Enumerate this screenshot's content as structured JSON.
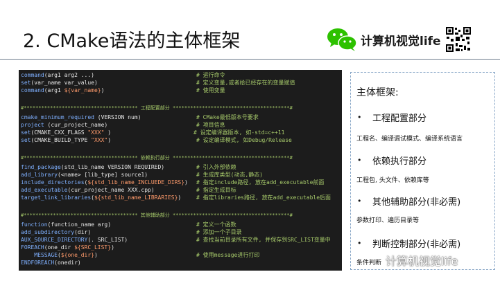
{
  "slide": {
    "title": "2. CMake语法的主体框架",
    "brand": "计算机视觉life"
  },
  "code": {
    "block1": [
      {
        "cmd": "command",
        "args": "(arg1 arg2 ...)",
        "comment": "# 运行命令"
      },
      {
        "cmd": "set",
        "args": "(var_name var_value)",
        "comment": "# 定义变量,或者给已经存在的变量赋值"
      },
      {
        "cmd": "command",
        "args": "(arg1 ${var_name})",
        "comment": "# 使用变量"
      }
    ],
    "header1": "#*************************************** 工程配置部分 ****************************************#",
    "block2": [
      {
        "cmd": "cmake_minimum_required",
        "args": " (VERSION num)",
        "comment": "# CMake最低版本号要求"
      },
      {
        "cmd": "project",
        "args": " (cur_project_name)",
        "comment": "# 项目信息"
      },
      {
        "cmd": "set",
        "args": "(CMAKE_CXX_FLAGS \"XXX\" )",
        "comment": "# 设定编译器版本, 如-std=c++11"
      },
      {
        "cmd": "set",
        "args": "(CMAKE_BUILD_TYPE \"XXX\")",
        "comment": "# 设定编译模式, 如Debug/Release"
      }
    ],
    "header2": "#*************************************** 依赖执行部分 ****************************************#",
    "block3": [
      {
        "cmd": "find_package",
        "args": "(std_lib_name VERSION REQUIRED)",
        "comment": "# 引入外部依赖"
      },
      {
        "cmd": "add_library",
        "args": "(<name> [lib_type] source1)",
        "comment": "# 生成库类型(动态,静态)"
      },
      {
        "cmd": "include_directories",
        "args": "(${std_lib_name_INCLUEDE_DIRS})",
        "comment": "# 指定include路径, 放在add_executable前面"
      },
      {
        "cmd": "add_executable",
        "args": "(cur_project_name XXX.cpp)",
        "comment": "# 指定生成目标"
      },
      {
        "cmd": "target_link_libraries",
        "args": "(${std_lib_name_LIBRARIES})",
        "comment": "# 指定libraries路径, 放在add_executable后面"
      }
    ],
    "header3": "#*************************************** 其他辅助部分 ****************************************#",
    "block4": [
      {
        "cmd": "function",
        "args": "(function_name arg)",
        "comment": "# 定义一个函数"
      },
      {
        "cmd": "add_subdirectory",
        "args": "(dir)",
        "comment": "# 添加一个子目录"
      },
      {
        "cmd": "AUX_SOURCE_DIRECTORY",
        "args": "(. SRC_LIST)",
        "comment": "# 查找当前目录所有文件, 并保存到SRC_LIST变量中"
      },
      {
        "cmd": "FOREACH",
        "args": "(one_dir ${SRC_LIST})",
        "comment": ""
      },
      {
        "cmd": "    MESSAGE",
        "args": "(${one_dir})",
        "comment": "# 使用message进行打印"
      },
      {
        "cmd": "ENDFOREACH",
        "args": "(onedir)",
        "comment": ""
      }
    ]
  },
  "card": {
    "title": "主体框架:",
    "bullet": "•",
    "items": [
      {
        "label": "工程配置部分",
        "detail": "工程名、编译调试模式、编译系统语言"
      },
      {
        "label": "依赖执行部分",
        "detail": "工程包, 头文件、依赖库等"
      },
      {
        "label": "其他辅助部分(非必需)",
        "detail": "参数打印、遍历目录等"
      },
      {
        "label": "判断控制部分(非必需)",
        "detail": "条件判断"
      }
    ]
  },
  "watermark": "计算机视觉life",
  "colors": {
    "code_bg": "#1c1c1c",
    "command": "#7fb0ff",
    "comment": "#a6c96a",
    "variable": "#ff9b6b",
    "card_border": "#8aa8c8",
    "wechat_green": "#2dc100"
  }
}
